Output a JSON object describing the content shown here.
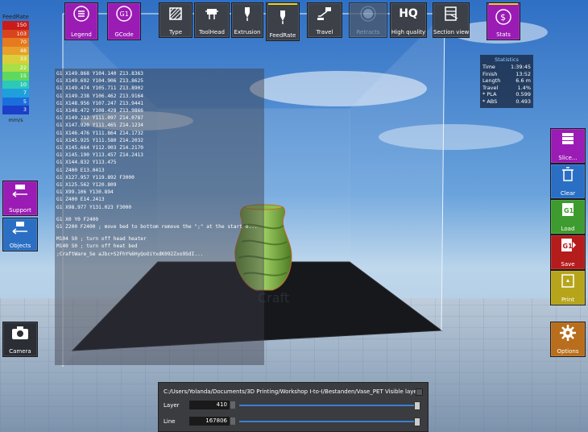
{
  "toolbar": {
    "legend": "Legend",
    "gcode": "GCode",
    "gcode_badge": "G1",
    "type": "Type",
    "toolhead": "ToolHead",
    "extrusion": "Extrusion",
    "feedrate": "FeedRate",
    "travel": "Travel",
    "retracts": "Retracts",
    "hq_badge": "HQ",
    "high_quality": "High quality",
    "section_view": "Section view",
    "stats": "Stats"
  },
  "legend": {
    "title": "FeedRate",
    "unit": "mm/s",
    "rows": [
      {
        "value": "150",
        "color": "#c81c1c"
      },
      {
        "value": "103",
        "color": "#d9441c"
      },
      {
        "value": "70",
        "color": "#e57a1f"
      },
      {
        "value": "48",
        "color": "#e8a02a"
      },
      {
        "value": "33",
        "color": "#d9cf3a"
      },
      {
        "value": "22",
        "color": "#a9df45"
      },
      {
        "value": "15",
        "color": "#5fd85f"
      },
      {
        "value": "10",
        "color": "#2cc9b9"
      },
      {
        "value": "7",
        "color": "#1fa0dc"
      },
      {
        "value": "5",
        "color": "#1b6fdc"
      },
      {
        "value": "3",
        "color": "#1b3fc8"
      }
    ]
  },
  "gcode_lines": [
    "G1 X149.868 Y104.140 Z13.8363",
    "G1 X149.692 Y104.906 Z13.8625",
    "G1 X149.474 Y105.711 Z13.8902",
    "G1 X149.238 Y106.462 Z13.9164",
    "G1 X148.956 Y107.247 Z13.9441",
    "G1 X148.472 Y108.428 Z13.9866",
    "G1 X149.212 Y111.097 Z14.0787",
    "G1 X147.920 Y111.465 Z14.1234",
    "G1 X146.476 Y111.864 Z14.1732",
    "G1 X145.925 Y111.580 Z14.2032",
    "G1 X145.664 Y112.903 Z14.2170",
    "G1 X145.190 Y113.457 Z14.2413",
    "G1 X144.832 Y113.475",
    "G1 Z400 E13.0413",
    "G1 X127.957 Y119.892 F3000",
    "G1 X125.562 Y120.809",
    "G1 X99.106 Y130.894",
    "G1 Z400 E14.2413",
    "G1 X98.977 Y131.023 F3000",
    "",
    "G1 X0 Y0 F2400",
    "G1 Z200 F2400 ; move bed to bottom remove the \";\" at the start o...",
    "",
    "M104 S0 ; turn off head heater",
    "M140 S0 ; turn off heat bed",
    ";CraftWare_Se                                   aJbc+S2FhY%6HyQoOiYxdK092Zxo9SdI..."
  ],
  "stats": {
    "title": "Statistics",
    "rows": [
      {
        "k": "Time",
        "v": "1:39:45"
      },
      {
        "k": "Finish",
        "v": "13:52"
      },
      {
        "k": "Length",
        "v": "6.6 m"
      },
      {
        "k": "Travel",
        "v": "1.4%"
      },
      {
        "k": "* PLA",
        "v": "0.599"
      },
      {
        "k": "* ABS",
        "v": "0.493"
      }
    ]
  },
  "sidebar_right": {
    "slice": "Slice...",
    "clear": "Clear",
    "load": "Load",
    "load_badge": "G1",
    "save": "Save",
    "save_badge": "G1",
    "print": "Print",
    "options": "Options"
  },
  "sidebar_left": {
    "support": "Support",
    "objects": "Objects",
    "camera": "Camera"
  },
  "bottom_panel": {
    "path": "C:/Users/Yolanda/Documents/3D Printing/Workshop I-to-I/Bestanden/Vase_PET",
    "visible_layers": "Visible layers",
    "layer_label": "Layer",
    "layer_value": "410",
    "line_label": "Line",
    "line_value": "167806"
  }
}
